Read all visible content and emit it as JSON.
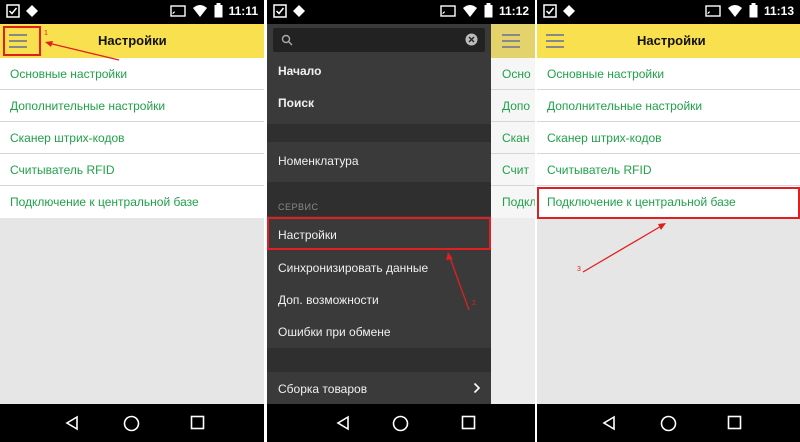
{
  "panels": [
    {
      "time": "11:11",
      "title": "Настройки",
      "items": [
        "Основные настройки",
        "Дополнительные настройки",
        "Сканер штрих-кодов",
        "Считыватель RFID",
        "Подключение к центральной базе"
      ],
      "annotation": "1"
    },
    {
      "time": "11:12",
      "drawer": {
        "start": "Начало",
        "search": "Поиск",
        "nomenclature": "Номенклатура",
        "section": "СЕРВИС",
        "settings": "Настройки",
        "sync": "Синхронизировать данные",
        "extras": "Доп. возможности",
        "errors": "Ошибки при обмене",
        "assembly": "Сборка товаров"
      },
      "background_items": [
        "Осно",
        "Допо",
        "Скан",
        "Счит",
        "Подкл"
      ],
      "annotation": "2"
    },
    {
      "time": "11:13",
      "title": "Настройки",
      "items": [
        "Основные настройки",
        "Дополнительные настройки",
        "Сканер штрих-кодов",
        "Считыватель RFID",
        "Подключение к центральной базе"
      ],
      "annotation": "3"
    }
  ],
  "colors": {
    "appbar": "#f9e04f",
    "item_text": "#1fa14a",
    "highlight": "#e02020",
    "drawer_bg": "#3a3a3a"
  },
  "icons": [
    "menu-icon",
    "search-icon",
    "clear-icon",
    "chevron-right-icon",
    "back-icon",
    "home-icon",
    "recents-icon",
    "wifi-icon",
    "battery-icon",
    "cast-icon"
  ]
}
